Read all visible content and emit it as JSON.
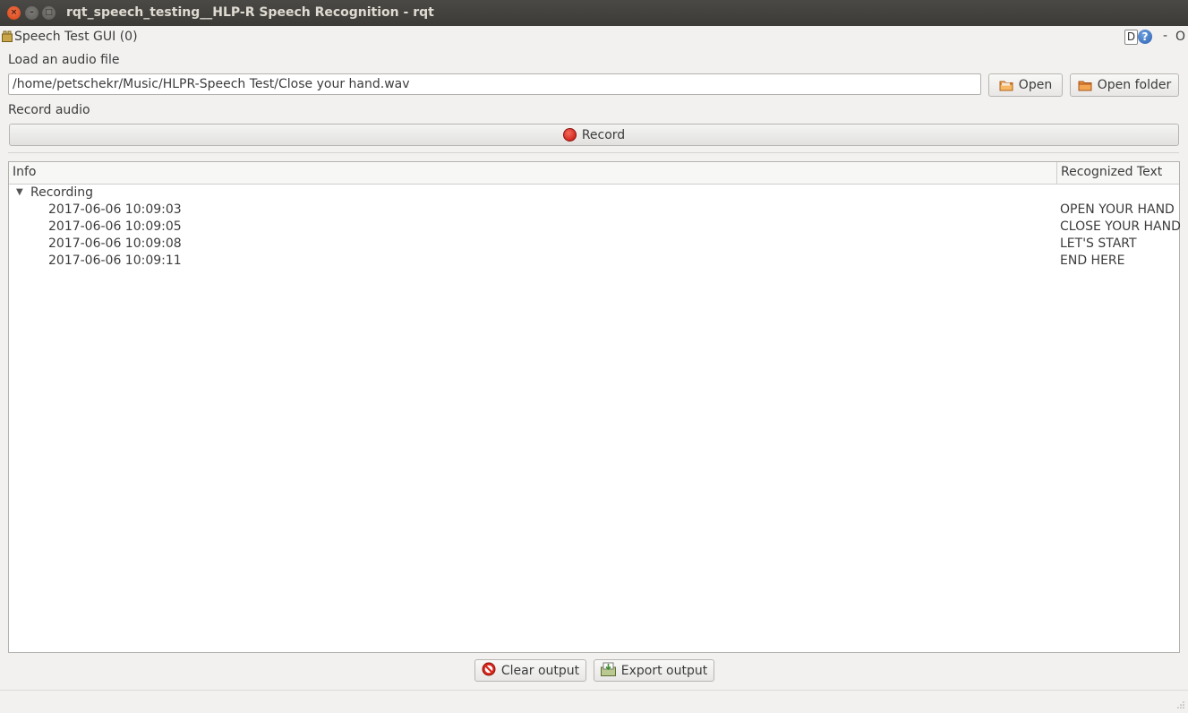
{
  "window": {
    "title": "rqt_speech_testing__HLP-R Speech Recognition - rqt",
    "close_glyph": "×",
    "min_glyph": "–",
    "max_glyph": "□"
  },
  "plugin": {
    "title": "Speech Test GUI (0)",
    "d_label": "D",
    "help_label": "?",
    "dash_label": "-",
    "o_label": "O"
  },
  "load": {
    "label": "Load an audio file",
    "path_value": "/home/petschekr/Music/HLPR-Speech Test/Close your hand.wav",
    "open_label": "Open",
    "open_folder_label": "Open folder"
  },
  "record": {
    "label": "Record audio",
    "button_label": "Record"
  },
  "tree": {
    "col_info": "Info",
    "col_text": "Recognized Text",
    "parent_label": "Recording",
    "expand_glyph": "▼",
    "rows": [
      {
        "time": "2017-06-06 10:09:03",
        "text": "OPEN YOUR HAND"
      },
      {
        "time": "2017-06-06 10:09:05",
        "text": "CLOSE YOUR HAND"
      },
      {
        "time": "2017-06-06 10:09:08",
        "text": "LET'S START"
      },
      {
        "time": "2017-06-06 10:09:11",
        "text": "END HERE"
      }
    ]
  },
  "actions": {
    "clear_label": "Clear output",
    "export_label": "Export output"
  },
  "colors": {
    "titlebar": "#3c3b37",
    "close_button": "#e2531e",
    "record_dot": "#d7140e",
    "window_bg": "#f2f1f0"
  }
}
